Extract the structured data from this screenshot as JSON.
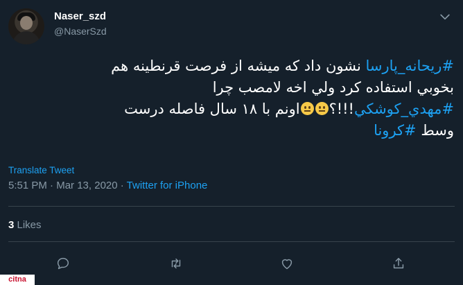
{
  "author": {
    "display_name": "Naser_szd",
    "handle": "@NaserSzd"
  },
  "tweet": {
    "line1_hashtag": "#ريحانه_پارسا",
    "line1_text": " نشون داد که میشه از فرصت قرنطینه هم",
    "line2_text": "بخوبي استفاده کرد ولي اخه لامصب چرا",
    "line3_hashtag": "#مهدي_کوشکي",
    "line3_punct": "!!!؟",
    "line3_text": "اونم با ۱۸ سال فاصله درست",
    "line4_text": "وسط ",
    "line4_hashtag": "#کرونا",
    "emoji_names": [
      "neutral-face",
      "neutral-face"
    ]
  },
  "translate_label": "Translate Tweet",
  "meta": {
    "time": "5:51 PM",
    "separator": " · ",
    "date": "Mar 13, 2020",
    "source": "Twitter for iPhone"
  },
  "stats": {
    "likes_count": "3",
    "likes_label": " Likes"
  },
  "actions": [
    "reply-icon",
    "retweet-icon",
    "like-icon",
    "share-icon"
  ],
  "watermark": "citna",
  "colors": {
    "background": "#15202b",
    "accent": "#1da1f2",
    "secondary_text": "#8899a6",
    "divider": "#38444d"
  }
}
